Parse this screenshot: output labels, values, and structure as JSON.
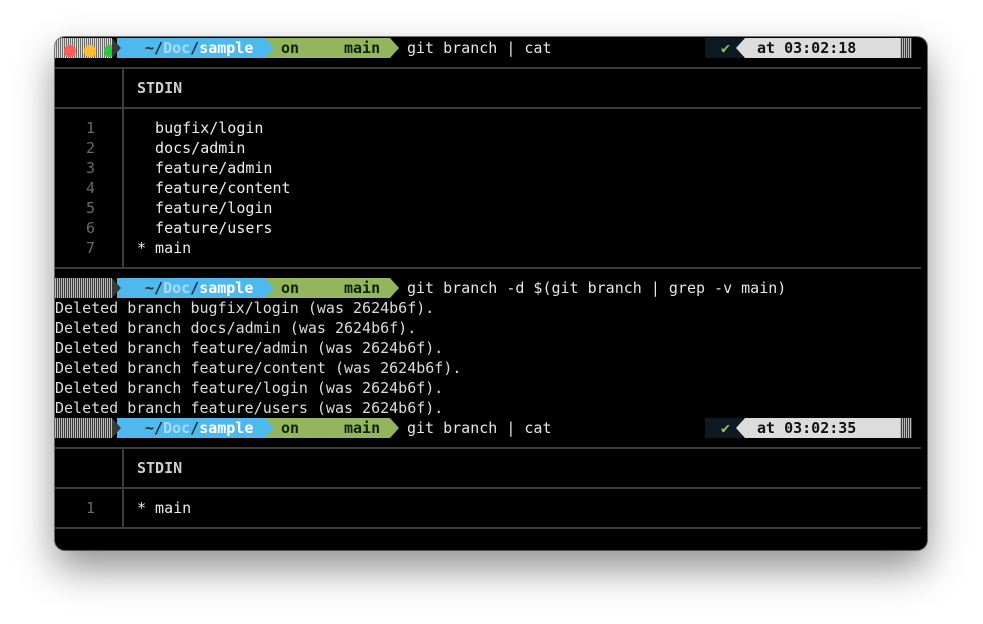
{
  "prompt1": {
    "path_prefix": "~/",
    "path_dir": "Doc",
    "path_sep": "/",
    "path_name": "sample",
    "git_on": "on",
    "branch": "main",
    "command": "git branch | cat",
    "check": "✔",
    "time": "at 03:02:18"
  },
  "table1": {
    "header": "STDIN",
    "lines": [
      {
        "num": "1",
        "text": "  bugfix/login"
      },
      {
        "num": "2",
        "text": "  docs/admin"
      },
      {
        "num": "3",
        "text": "  feature/admin"
      },
      {
        "num": "4",
        "text": "  feature/content"
      },
      {
        "num": "5",
        "text": "  feature/login"
      },
      {
        "num": "6",
        "text": "  feature/users"
      },
      {
        "num": "7",
        "text": "* main"
      }
    ]
  },
  "prompt2": {
    "path_prefix": "~/",
    "path_dir": "Doc",
    "path_sep": "/",
    "path_name": "sample",
    "git_on": "on",
    "branch": "main",
    "command": "git branch -d $(git branch | grep -v main)"
  },
  "output": [
    "Deleted branch bugfix/login (was 2624b6f).",
    "Deleted branch docs/admin (was 2624b6f).",
    "Deleted branch feature/admin (was 2624b6f).",
    "Deleted branch feature/content (was 2624b6f).",
    "Deleted branch feature/login (was 2624b6f).",
    "Deleted branch feature/users (was 2624b6f)."
  ],
  "prompt3": {
    "path_prefix": "~/",
    "path_dir": "Doc",
    "path_sep": "/",
    "path_name": "sample",
    "git_on": "on",
    "branch": "main",
    "command": "git branch | cat",
    "check": "✔",
    "time": "at 03:02:35"
  },
  "table2": {
    "header": "STDIN",
    "lines": [
      {
        "num": "1",
        "text": "* main"
      }
    ]
  },
  "colors": {
    "path_bg": "#4fb8ed",
    "git_bg": "#92b55d",
    "close": "#ff5f57",
    "minimize": "#febc2e",
    "zoom": "#28c840",
    "check": "#8cc265"
  }
}
